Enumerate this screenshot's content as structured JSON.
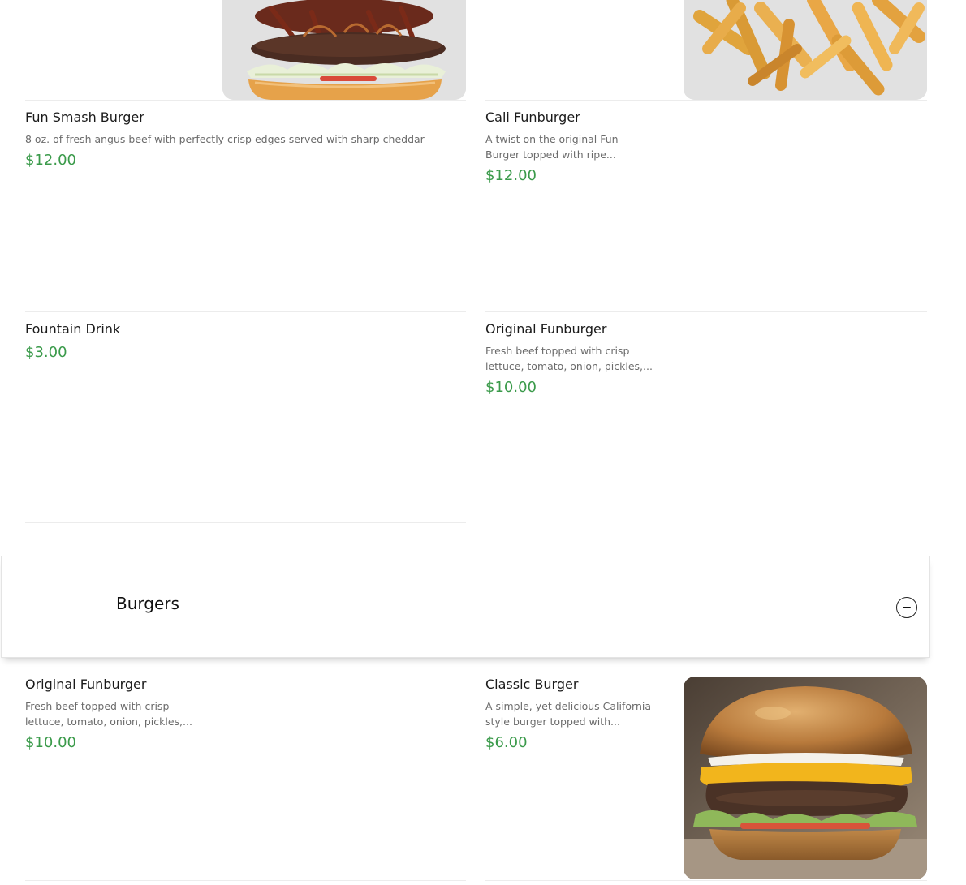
{
  "top_section": {
    "items": [
      {
        "name": "Fun Smash Burger",
        "description": "8 oz. of fresh angus beef with perfectly crisp edges served with sharp cheddar",
        "price": "$12.00",
        "image": "burger-photo"
      },
      {
        "name": "Cali Funburger",
        "description": "A twist on the original Fun Burger topped with ripe...",
        "price": "$12.00",
        "image": "fries-photo"
      },
      {
        "name": "Fountain Drink",
        "price": "$3.00"
      },
      {
        "name": "Original Funburger",
        "description": "Fresh beef topped with crisp lettuce, tomato, onion, pickles,...",
        "price": "$10.00"
      }
    ]
  },
  "burgers_section": {
    "title": "Burgers",
    "collapse_icon": "minus-circle-icon",
    "items": [
      {
        "name": "Original Funburger",
        "description": "Fresh beef topped with crisp lettuce, tomato, onion, pickles,...",
        "price": "$10.00"
      },
      {
        "name": "Classic Burger",
        "description": "A simple, yet delicious California style burger topped with...",
        "price": "$6.00",
        "image": "cheeseburger-photo"
      }
    ]
  },
  "colors": {
    "price": "#3a9a4a",
    "divider": "#ececec",
    "text": "#1a1a1a",
    "muted": "#6b6b6b"
  }
}
